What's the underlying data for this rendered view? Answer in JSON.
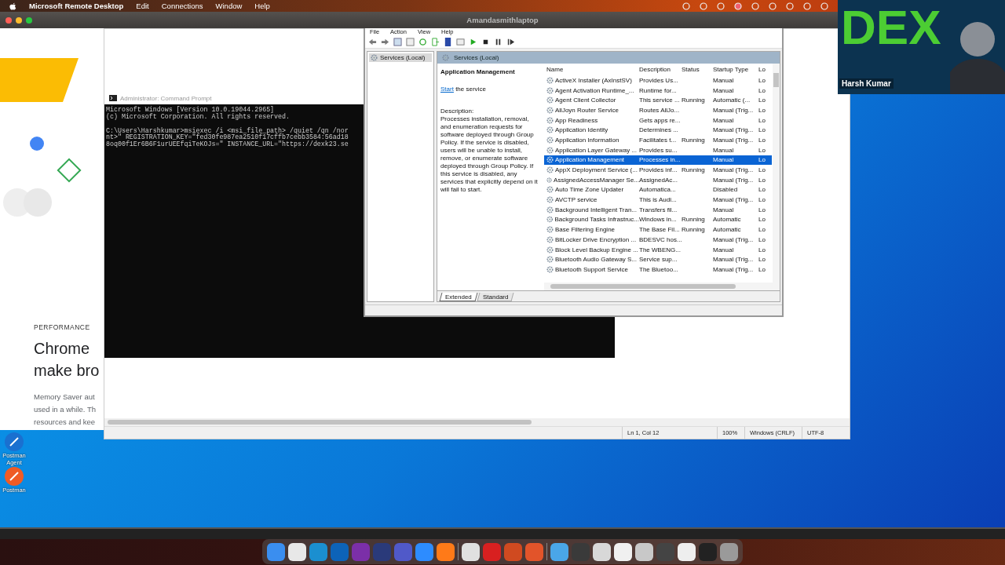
{
  "menubar": {
    "app": "Microsoft Remote Desktop",
    "menus": [
      "Edit",
      "Connections",
      "Window",
      "Help"
    ]
  },
  "rdp_window": {
    "title": "Amandasmithlaptop"
  },
  "web_page": {
    "eyebrow": "PERFORMANCE",
    "heading_lines": [
      "Chrome",
      "make bro"
    ],
    "body_lines": [
      "Memory Saver aut",
      "used in a while. Th",
      "resources and kee"
    ]
  },
  "notepad": {
    "status": [
      "Ln 1, Col 12",
      "100%",
      "Windows (CRLF)",
      "UTF-8"
    ]
  },
  "command_prompt": {
    "title": "Administrator: Command Prompt",
    "header_lines": [
      "Microsoft Windows [Version 10.0.19044.2965]",
      "(c) Microsoft Corporation. All rights reserved."
    ],
    "command_lines": [
      "C:\\Users\\Harshkumar>msiexec /i <msi_file_path> /quiet /qn /nor",
      "nt>\" REGISTRATION_KEY=\"fed30fe987ea2510f17cffb7cebb3584:56ad18",
      "8oq00f1Er6B6F1urUEEfqiTeKOJs=\" INSTANCE_URL=\"https://dexk23.se"
    ]
  },
  "services": {
    "menu": [
      "File",
      "Action",
      "View",
      "Help"
    ],
    "tree": [
      {
        "label": "Services (Local)",
        "selected": true
      }
    ],
    "header": "Services (Local)",
    "detail": {
      "title": "Application Management",
      "link": "Start",
      "link_rest": "the service",
      "description_label": "Description:",
      "description": "Processes installation, removal, and enumeration requests for software deployed through Group Policy. If the service is disabled, users will be unable to install, remove, or enumerate software deployed through Group Policy. If this service is disabled, any services that explicitly depend on it will fail to start."
    },
    "columns": [
      "Name",
      "Description",
      "Status",
      "Startup Type",
      "Lo"
    ],
    "rows": [
      {
        "name": "ActiveX Installer (AxInstSV)",
        "description": "Provides Us...",
        "status": "",
        "startup": "Manual",
        "logon": "Lo",
        "selected": false
      },
      {
        "name": "Agent Activation Runtime_...",
        "description": "Runtime for...",
        "status": "",
        "startup": "Manual",
        "logon": "Lo",
        "selected": false
      },
      {
        "name": "Agent Client Collector",
        "description": "This service ...",
        "status": "Running",
        "startup": "Automatic (...",
        "logon": "Lo",
        "selected": false
      },
      {
        "name": "AllJoyn Router Service",
        "description": "Routes AllJo...",
        "status": "",
        "startup": "Manual (Trig...",
        "logon": "Lo",
        "selected": false
      },
      {
        "name": "App Readiness",
        "description": "Gets apps re...",
        "status": "",
        "startup": "Manual",
        "logon": "Lo",
        "selected": false
      },
      {
        "name": "Application Identity",
        "description": "Determines ...",
        "status": "",
        "startup": "Manual (Trig...",
        "logon": "Lo",
        "selected": false
      },
      {
        "name": "Application Information",
        "description": "Facilitates t...",
        "status": "Running",
        "startup": "Manual (Trig...",
        "logon": "Lo",
        "selected": false
      },
      {
        "name": "Application Layer Gateway ...",
        "description": "Provides su...",
        "status": "",
        "startup": "Manual",
        "logon": "Lo",
        "selected": false
      },
      {
        "name": "Application Management",
        "description": "Processes in...",
        "status": "",
        "startup": "Manual",
        "logon": "Lo",
        "selected": true
      },
      {
        "name": "AppX Deployment Service (...",
        "description": "Provides inf...",
        "status": "Running",
        "startup": "Manual (Trig...",
        "logon": "Lo",
        "selected": false
      },
      {
        "name": "AssignedAccessManager Se...",
        "description": "AssignedAc...",
        "status": "",
        "startup": "Manual (Trig...",
        "logon": "Lo",
        "selected": false
      },
      {
        "name": "Auto Time Zone Updater",
        "description": "Automatica...",
        "status": "",
        "startup": "Disabled",
        "logon": "Lo",
        "selected": false
      },
      {
        "name": "AVCTP service",
        "description": "This is Audi...",
        "status": "",
        "startup": "Manual (Trig...",
        "logon": "Lo",
        "selected": false
      },
      {
        "name": "Background Intelligent Tran...",
        "description": "Transfers fil...",
        "status": "",
        "startup": "Manual",
        "logon": "Lo",
        "selected": false
      },
      {
        "name": "Background Tasks Infrastruc...",
        "description": "Windows in...",
        "status": "Running",
        "startup": "Automatic",
        "logon": "Lo",
        "selected": false
      },
      {
        "name": "Base Filtering Engine",
        "description": "The Base Fil...",
        "status": "Running",
        "startup": "Automatic",
        "logon": "Lo",
        "selected": false
      },
      {
        "name": "BitLocker Drive Encryption ...",
        "description": "BDESVC hos...",
        "status": "",
        "startup": "Manual (Trig...",
        "logon": "Lo",
        "selected": false
      },
      {
        "name": "Block Level Backup Engine ...",
        "description": "The WBENG...",
        "status": "",
        "startup": "Manual",
        "logon": "Lo",
        "selected": false
      },
      {
        "name": "Bluetooth Audio Gateway S...",
        "description": "Service sup...",
        "status": "",
        "startup": "Manual (Trig...",
        "logon": "Lo",
        "selected": false
      },
      {
        "name": "Bluetooth Support Service",
        "description": "The Bluetoo...",
        "status": "",
        "startup": "Manual (Trig...",
        "logon": "Lo",
        "selected": false
      }
    ],
    "tabs": [
      {
        "label": "Extended",
        "selected": true
      },
      {
        "label": "Standard",
        "selected": false
      }
    ]
  },
  "desktop_icons": [
    {
      "label": "Postman Agent"
    },
    {
      "label": "Postman"
    }
  ],
  "webcam": {
    "logo": "DEX",
    "name": "Harsh Kumar"
  }
}
